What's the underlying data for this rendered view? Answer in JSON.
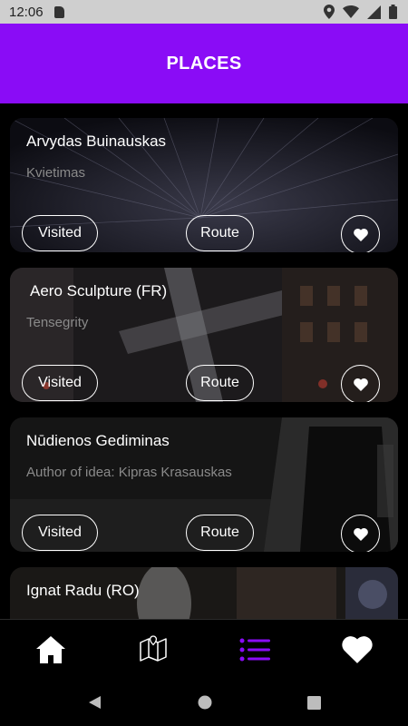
{
  "status_bar": {
    "time": "12:06",
    "icons": [
      "sd-card-icon",
      "location-icon",
      "wifi-icon",
      "signal-icon",
      "battery-icon"
    ]
  },
  "header": {
    "title": "PLACES"
  },
  "places": [
    {
      "title": "Arvydas Buinauskas",
      "subtitle": "Kvietimas",
      "visited_label": "Visited",
      "route_label": "Route"
    },
    {
      "title": "Aero Sculpture (FR)",
      "subtitle": "Tensegrity",
      "visited_label": "Visited",
      "route_label": "Route"
    },
    {
      "title": "Nūdienos Gediminas",
      "subtitle": "Author of idea: Kipras Krasauskas",
      "visited_label": "Visited",
      "route_label": "Route"
    },
    {
      "title": "Ignat Radu (RO)",
      "subtitle": "",
      "visited_label": "",
      "route_label": ""
    }
  ],
  "bottom_nav": {
    "items": [
      "home-icon",
      "map-icon",
      "list-icon",
      "favorites-icon"
    ],
    "active": "list-icon",
    "active_color": "#8a0cf6"
  },
  "colors": {
    "accent": "#8a0cf6",
    "background": "#000000"
  }
}
